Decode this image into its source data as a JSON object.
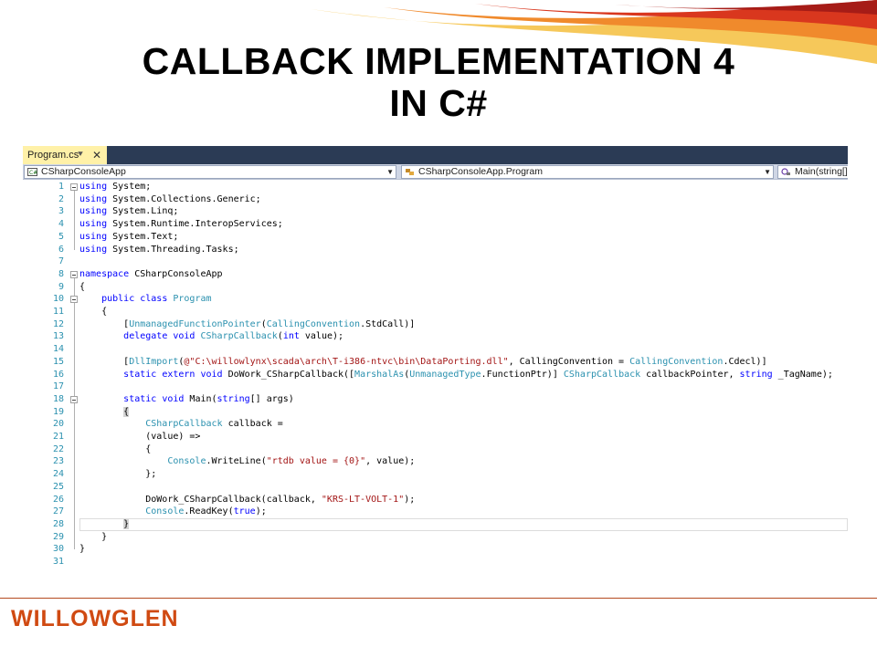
{
  "slide": {
    "title_line1": "CALLBACK IMPLEMENTATION 4",
    "title_line2": "IN C#",
    "logo_text": "WILLOWGLEN"
  },
  "ide": {
    "tab": {
      "label": "Program.cs",
      "pin_icon": "pin-icon",
      "close_icon": "close-icon"
    },
    "nav": {
      "project": "CSharpConsoleApp",
      "class": "CSharpConsoleApp.Program",
      "member": "Main(string[]"
    }
  },
  "colors": {
    "keyword": "#0000ff",
    "type": "#2b91af",
    "string": "#a31515",
    "accent_orange": "#d04a12"
  },
  "code_lines": [
    {
      "n": "1",
      "segments": [
        [
          "kw",
          "using"
        ],
        [
          "",
          "System;"
        ]
      ]
    },
    {
      "n": "2",
      "segments": [
        [
          "kw",
          "using"
        ],
        [
          "",
          "System.Collections.Generic;"
        ]
      ]
    },
    {
      "n": "3",
      "segments": [
        [
          "kw",
          "using"
        ],
        [
          "",
          "System.Linq;"
        ]
      ]
    },
    {
      "n": "4",
      "segments": [
        [
          "kw",
          "using"
        ],
        [
          "",
          "System.Runtime.InteropServices;"
        ]
      ]
    },
    {
      "n": "5",
      "segments": [
        [
          "kw",
          "using"
        ],
        [
          "",
          "System.Text;"
        ]
      ]
    },
    {
      "n": "6",
      "segments": [
        [
          "kw",
          "using"
        ],
        [
          "",
          "System.Threading.Tasks;"
        ]
      ]
    },
    {
      "n": "7",
      "segments": []
    },
    {
      "n": "8",
      "segments": [
        [
          "kw",
          "namespace"
        ],
        [
          "",
          " CSharpConsoleApp"
        ]
      ]
    },
    {
      "n": "9",
      "segments": [
        [
          "",
          "{"
        ]
      ]
    },
    {
      "n": "10",
      "segments": [
        [
          "",
          "    "
        ],
        [
          "kw",
          "public class"
        ],
        [
          "",
          " "
        ],
        [
          "ty",
          "Program"
        ]
      ]
    },
    {
      "n": "11",
      "segments": [
        [
          "",
          "    {"
        ]
      ]
    },
    {
      "n": "12",
      "segments": [
        [
          "",
          "        ["
        ],
        [
          "ty",
          "UnmanagedFunctionPointer"
        ],
        [
          "",
          "("
        ],
        [
          "ty",
          "CallingConvention"
        ],
        [
          "",
          ".StdCall)]"
        ]
      ]
    },
    {
      "n": "13",
      "segments": [
        [
          "",
          "        "
        ],
        [
          "kw",
          "delegate void"
        ],
        [
          "",
          " "
        ],
        [
          "ty",
          "CSharpCallback"
        ],
        [
          "",
          "("
        ],
        [
          "kw",
          "int"
        ],
        [
          "",
          " value);"
        ]
      ]
    },
    {
      "n": "14",
      "segments": []
    },
    {
      "n": "15",
      "segments": [
        [
          "",
          "        ["
        ],
        [
          "ty",
          "DllImport"
        ],
        [
          "",
          "("
        ],
        [
          "st",
          "@\"C:\\willowlynx\\scada\\arch\\T-i386-ntvc\\bin\\DataPorting.dll\""
        ],
        [
          "",
          ", CallingConvention = "
        ],
        [
          "ty",
          "CallingConvention"
        ],
        [
          "",
          ".Cdecl)]"
        ]
      ]
    },
    {
      "n": "16",
      "segments": [
        [
          "",
          "        "
        ],
        [
          "kw",
          "static extern void"
        ],
        [
          "",
          " DoWork_CSharpCallback(["
        ],
        [
          "ty",
          "MarshalAs"
        ],
        [
          "",
          "("
        ],
        [
          "ty",
          "UnmanagedType"
        ],
        [
          "",
          ".FunctionPtr)] "
        ],
        [
          "ty",
          "CSharpCallback"
        ],
        [
          "",
          " callbackPointer, "
        ],
        [
          "kw",
          "string"
        ],
        [
          "",
          " _TagName);"
        ]
      ]
    },
    {
      "n": "17",
      "segments": []
    },
    {
      "n": "18",
      "segments": [
        [
          "",
          "        "
        ],
        [
          "kw",
          "static void"
        ],
        [
          "",
          " Main("
        ],
        [
          "kw",
          "string"
        ],
        [
          "",
          "[] args)"
        ]
      ]
    },
    {
      "n": "19",
      "segments": [
        [
          "",
          "        "
        ],
        [
          "bh",
          "{"
        ]
      ]
    },
    {
      "n": "20",
      "segments": [
        [
          "",
          "            "
        ],
        [
          "ty",
          "CSharpCallback"
        ],
        [
          "",
          " callback ="
        ]
      ]
    },
    {
      "n": "21",
      "segments": [
        [
          "",
          "            (value) =>"
        ]
      ]
    },
    {
      "n": "22",
      "segments": [
        [
          "",
          "            {"
        ]
      ]
    },
    {
      "n": "23",
      "segments": [
        [
          "",
          "                "
        ],
        [
          "ty",
          "Console"
        ],
        [
          "",
          ".WriteLine("
        ],
        [
          "st",
          "\"rtdb value = {0}\""
        ],
        [
          "",
          ", value);"
        ]
      ]
    },
    {
      "n": "24",
      "segments": [
        [
          "",
          "            };"
        ]
      ]
    },
    {
      "n": "25",
      "segments": []
    },
    {
      "n": "26",
      "segments": [
        [
          "",
          "            DoWork_CSharpCallback(callback, "
        ],
        [
          "st",
          "\"KRS-LT-VOLT-1\""
        ],
        [
          "",
          ");"
        ]
      ]
    },
    {
      "n": "27",
      "segments": [
        [
          "",
          "            "
        ],
        [
          "ty",
          "Console"
        ],
        [
          "",
          ".ReadKey("
        ],
        [
          "kw",
          "true"
        ],
        [
          "",
          ");"
        ]
      ]
    },
    {
      "n": "28",
      "segments": [
        [
          "",
          "        "
        ],
        [
          "bh",
          "}"
        ]
      ]
    },
    {
      "n": "29",
      "segments": [
        [
          "",
          "    }"
        ]
      ]
    },
    {
      "n": "30",
      "segments": [
        [
          "",
          "}"
        ]
      ]
    },
    {
      "n": "31",
      "segments": []
    }
  ]
}
